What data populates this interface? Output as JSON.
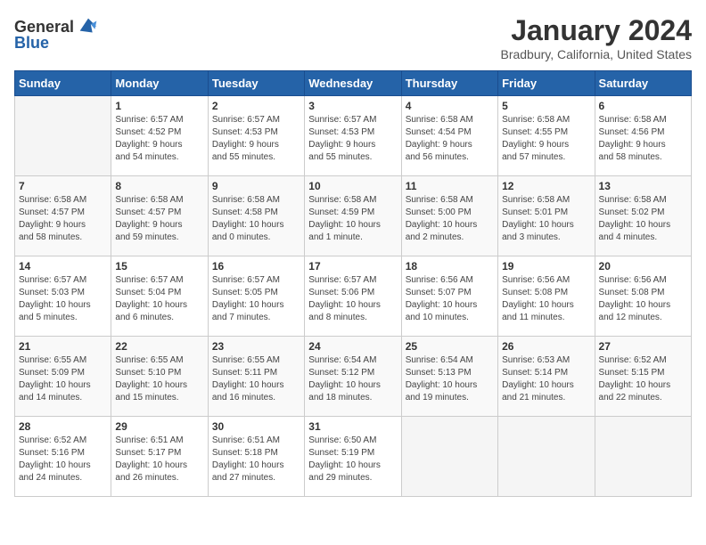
{
  "header": {
    "logo_general": "General",
    "logo_blue": "Blue",
    "month_year": "January 2024",
    "location": "Bradbury, California, United States"
  },
  "calendar": {
    "days_of_week": [
      "Sunday",
      "Monday",
      "Tuesday",
      "Wednesday",
      "Thursday",
      "Friday",
      "Saturday"
    ],
    "weeks": [
      [
        {
          "day": "",
          "info": ""
        },
        {
          "day": "1",
          "info": "Sunrise: 6:57 AM\nSunset: 4:52 PM\nDaylight: 9 hours\nand 54 minutes."
        },
        {
          "day": "2",
          "info": "Sunrise: 6:57 AM\nSunset: 4:53 PM\nDaylight: 9 hours\nand 55 minutes."
        },
        {
          "day": "3",
          "info": "Sunrise: 6:57 AM\nSunset: 4:53 PM\nDaylight: 9 hours\nand 55 minutes."
        },
        {
          "day": "4",
          "info": "Sunrise: 6:58 AM\nSunset: 4:54 PM\nDaylight: 9 hours\nand 56 minutes."
        },
        {
          "day": "5",
          "info": "Sunrise: 6:58 AM\nSunset: 4:55 PM\nDaylight: 9 hours\nand 57 minutes."
        },
        {
          "day": "6",
          "info": "Sunrise: 6:58 AM\nSunset: 4:56 PM\nDaylight: 9 hours\nand 58 minutes."
        }
      ],
      [
        {
          "day": "7",
          "info": "Sunrise: 6:58 AM\nSunset: 4:57 PM\nDaylight: 9 hours\nand 58 minutes."
        },
        {
          "day": "8",
          "info": "Sunrise: 6:58 AM\nSunset: 4:57 PM\nDaylight: 9 hours\nand 59 minutes."
        },
        {
          "day": "9",
          "info": "Sunrise: 6:58 AM\nSunset: 4:58 PM\nDaylight: 10 hours\nand 0 minutes."
        },
        {
          "day": "10",
          "info": "Sunrise: 6:58 AM\nSunset: 4:59 PM\nDaylight: 10 hours\nand 1 minute."
        },
        {
          "day": "11",
          "info": "Sunrise: 6:58 AM\nSunset: 5:00 PM\nDaylight: 10 hours\nand 2 minutes."
        },
        {
          "day": "12",
          "info": "Sunrise: 6:58 AM\nSunset: 5:01 PM\nDaylight: 10 hours\nand 3 minutes."
        },
        {
          "day": "13",
          "info": "Sunrise: 6:58 AM\nSunset: 5:02 PM\nDaylight: 10 hours\nand 4 minutes."
        }
      ],
      [
        {
          "day": "14",
          "info": "Sunrise: 6:57 AM\nSunset: 5:03 PM\nDaylight: 10 hours\nand 5 minutes."
        },
        {
          "day": "15",
          "info": "Sunrise: 6:57 AM\nSunset: 5:04 PM\nDaylight: 10 hours\nand 6 minutes."
        },
        {
          "day": "16",
          "info": "Sunrise: 6:57 AM\nSunset: 5:05 PM\nDaylight: 10 hours\nand 7 minutes."
        },
        {
          "day": "17",
          "info": "Sunrise: 6:57 AM\nSunset: 5:06 PM\nDaylight: 10 hours\nand 8 minutes."
        },
        {
          "day": "18",
          "info": "Sunrise: 6:56 AM\nSunset: 5:07 PM\nDaylight: 10 hours\nand 10 minutes."
        },
        {
          "day": "19",
          "info": "Sunrise: 6:56 AM\nSunset: 5:08 PM\nDaylight: 10 hours\nand 11 minutes."
        },
        {
          "day": "20",
          "info": "Sunrise: 6:56 AM\nSunset: 5:08 PM\nDaylight: 10 hours\nand 12 minutes."
        }
      ],
      [
        {
          "day": "21",
          "info": "Sunrise: 6:55 AM\nSunset: 5:09 PM\nDaylight: 10 hours\nand 14 minutes."
        },
        {
          "day": "22",
          "info": "Sunrise: 6:55 AM\nSunset: 5:10 PM\nDaylight: 10 hours\nand 15 minutes."
        },
        {
          "day": "23",
          "info": "Sunrise: 6:55 AM\nSunset: 5:11 PM\nDaylight: 10 hours\nand 16 minutes."
        },
        {
          "day": "24",
          "info": "Sunrise: 6:54 AM\nSunset: 5:12 PM\nDaylight: 10 hours\nand 18 minutes."
        },
        {
          "day": "25",
          "info": "Sunrise: 6:54 AM\nSunset: 5:13 PM\nDaylight: 10 hours\nand 19 minutes."
        },
        {
          "day": "26",
          "info": "Sunrise: 6:53 AM\nSunset: 5:14 PM\nDaylight: 10 hours\nand 21 minutes."
        },
        {
          "day": "27",
          "info": "Sunrise: 6:52 AM\nSunset: 5:15 PM\nDaylight: 10 hours\nand 22 minutes."
        }
      ],
      [
        {
          "day": "28",
          "info": "Sunrise: 6:52 AM\nSunset: 5:16 PM\nDaylight: 10 hours\nand 24 minutes."
        },
        {
          "day": "29",
          "info": "Sunrise: 6:51 AM\nSunset: 5:17 PM\nDaylight: 10 hours\nand 26 minutes."
        },
        {
          "day": "30",
          "info": "Sunrise: 6:51 AM\nSunset: 5:18 PM\nDaylight: 10 hours\nand 27 minutes."
        },
        {
          "day": "31",
          "info": "Sunrise: 6:50 AM\nSunset: 5:19 PM\nDaylight: 10 hours\nand 29 minutes."
        },
        {
          "day": "",
          "info": ""
        },
        {
          "day": "",
          "info": ""
        },
        {
          "day": "",
          "info": ""
        }
      ]
    ]
  }
}
